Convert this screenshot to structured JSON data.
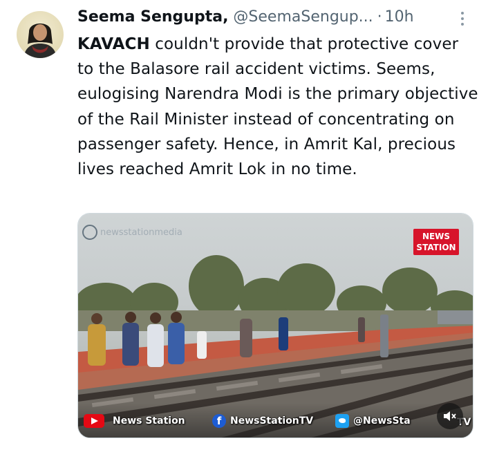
{
  "author": {
    "name": "Seema Sengupta,",
    "handle": "@SeemaSengup...",
    "separator": "·",
    "time": "10h"
  },
  "tweet": {
    "bold_word": "KAVACH",
    "text": " couldn't provide that protective cover to the Balasore rail accident victims. Seems, eulogising Narendra Modi is the primary objective of the Rail Minister instead of concentrating on passenger safety. Hence, in Amrit Kal, precious lives reached Amrit Lok in no time."
  },
  "media": {
    "watermark": "newsstationmedia",
    "logo_line1": "NEWS",
    "logo_line2": "STATION",
    "youtube_label": "News Station",
    "facebook_label": "NewsStationTV",
    "twitter_label": "@NewsSta",
    "twitter_tail": "TV",
    "icons": {
      "youtube": "youtube-icon",
      "facebook": "facebook-icon",
      "twitter": "twitter-icon",
      "mute": "mute-icon"
    }
  },
  "colors": {
    "text": "#0f1419",
    "secondary": "#536471",
    "logo_red": "#d7142a"
  }
}
